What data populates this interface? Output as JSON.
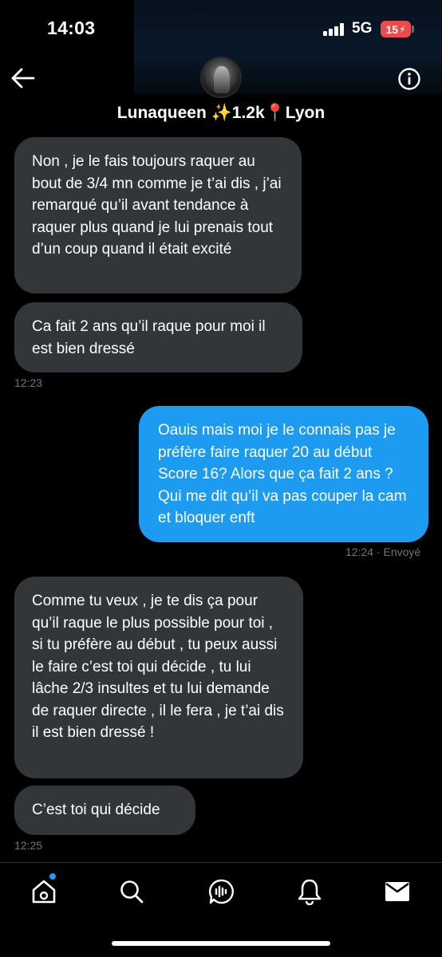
{
  "status_bar": {
    "time": "14:03",
    "network": "5G",
    "battery": "15"
  },
  "header": {
    "contact_name": "Lunaqueen ✨1.2k📍Lyon",
    "back_icon": "back-arrow-icon",
    "info_icon": "info-icon"
  },
  "messages": [
    {
      "from": "them",
      "text": "Non , je le fais toujours raquer au bout de 3/4 mn comme je t’ai dis , j’ai remarqué qu’il avant tendance à raquer plus quand je lui prenais tout d’un coup quand il était excité"
    },
    {
      "from": "them",
      "text": "Ca fait 2 ans qu’il raque pour moi il est bien dressé",
      "time": "12:23"
    },
    {
      "from": "me",
      "text": "Oauis mais moi je le connais pas je préfère faire raquer 20 au début Score 16? Alors que ça fait 2 ans ? Qui me dit qu’il va pas couper la cam et bloquer enft",
      "time": "12:24",
      "status": " · Envoyé"
    },
    {
      "from": "them",
      "text": "Comme tu veux , je te dis ça pour qu’il raque le plus possible pour toi , si tu préfère au début , tu peux aussi le faire c’est toi qui décide , tu lui lâche 2/3 insultes et tu lui demande de raquer directe , il le fera , je t’ai dis il est bien dressé !"
    },
    {
      "from": "them",
      "text": "C’est toi qui décide",
      "time": "12:25"
    }
  ],
  "tabs": [
    {
      "name": "home",
      "icon": "home-icon"
    },
    {
      "name": "search",
      "icon": "search-icon"
    },
    {
      "name": "spaces",
      "icon": "spaces-icon"
    },
    {
      "name": "notifications",
      "icon": "bell-icon"
    },
    {
      "name": "messages",
      "icon": "mail-icon"
    }
  ],
  "colors": {
    "background": "#000000",
    "incoming_bubble": "#333639",
    "outgoing_bubble": "#1d9bf0",
    "timestamp": "#71767b",
    "battery": "#eb4a4c"
  }
}
